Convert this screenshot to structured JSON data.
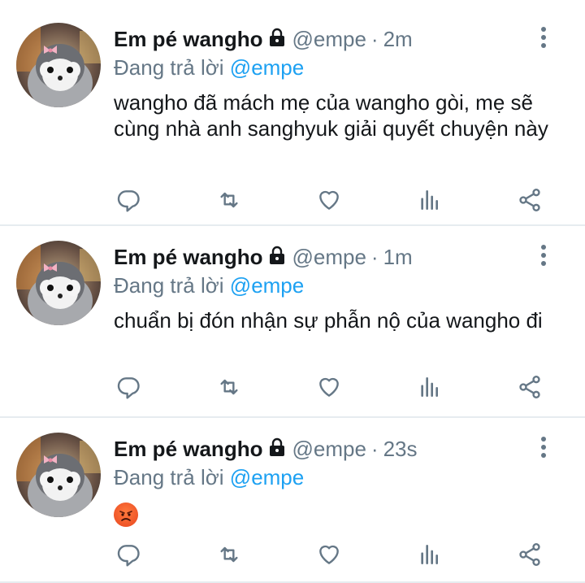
{
  "tweets": [
    {
      "name": "Em pé wangho",
      "handle": "@empe",
      "separator": "·",
      "time": "2m",
      "reply_prefix": "Đang trả lời",
      "reply_to": "@empe",
      "text": "wangho đã mách mẹ của wangho gòi, mẹ sẽ cùng nhà anh sanghyuk giải quyết chuyện này"
    },
    {
      "name": "Em pé wangho",
      "handle": "@empe",
      "separator": "·",
      "time": "1m",
      "reply_prefix": "Đang trả lời",
      "reply_to": "@empe",
      "text": "chuẩn bị đón nhận sự phẫn nộ của wangho đi"
    },
    {
      "name": "Em pé wangho",
      "handle": "@empe",
      "separator": "·",
      "time": "23s",
      "reply_prefix": "Đang trả lời",
      "reply_to": "@empe",
      "emoji": "angry-face-emoji"
    }
  ],
  "icons": {
    "lock": "lock-icon",
    "more": "more-vertical-icon",
    "reply": "reply-icon",
    "retweet": "retweet-icon",
    "like": "heart-icon",
    "analytics": "analytics-icon",
    "share": "share-icon"
  },
  "colors": {
    "name": "#14171a",
    "secondary": "#657786",
    "mention": "#1da1f2",
    "divider": "#e6ecf0"
  }
}
